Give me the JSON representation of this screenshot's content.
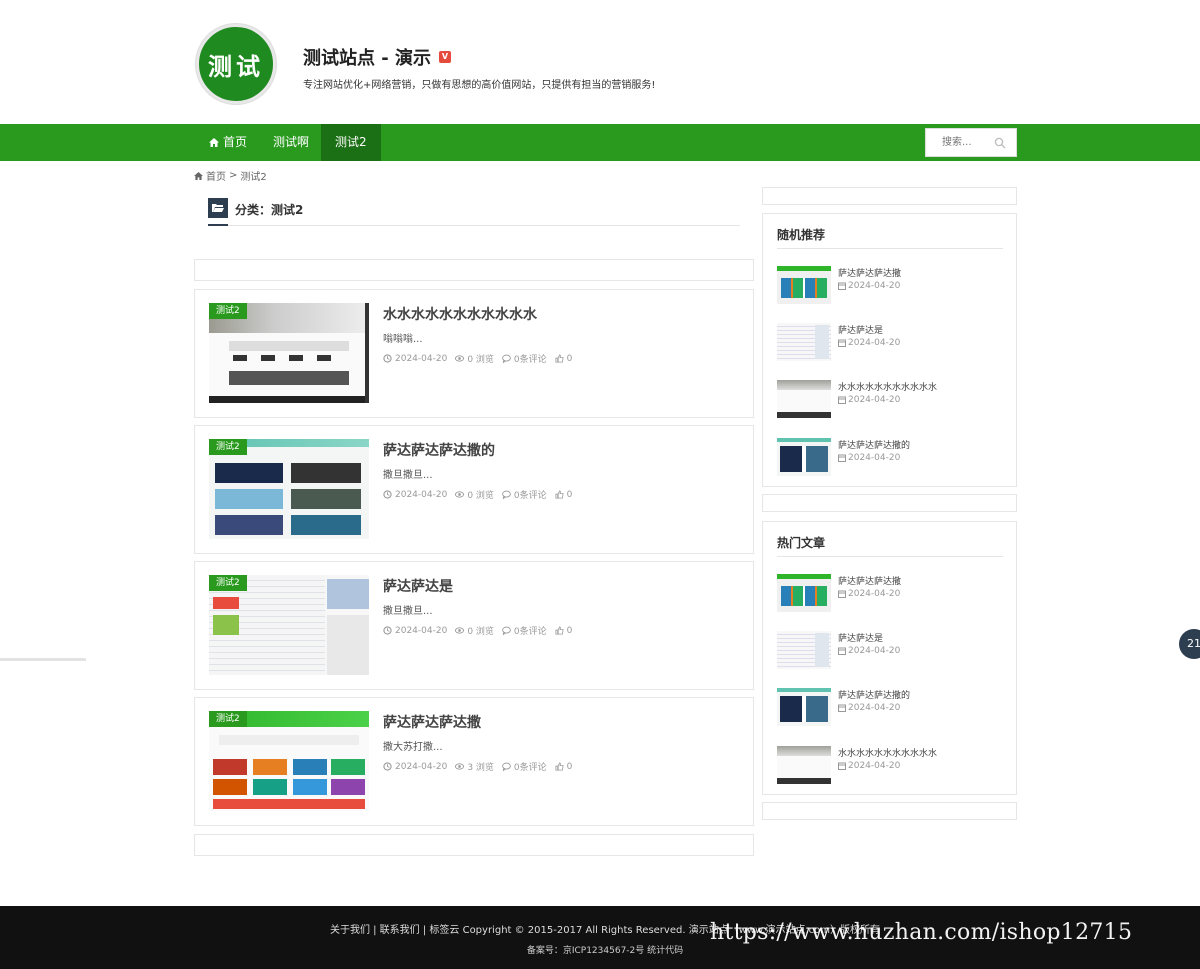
{
  "header": {
    "logo_text": "测试",
    "site_title": "测试站点 - 演示",
    "verified_badge": "V",
    "site_desc": "专注网站优化+网络营销，只做有思想的高价值网站，只提供有担当的营销服务!"
  },
  "nav": {
    "items": [
      {
        "label": "首页",
        "icon": "home-icon"
      },
      {
        "label": "测试啊"
      },
      {
        "label": "测试2",
        "active": true
      }
    ],
    "search_placeholder": "搜索..."
  },
  "breadcrumb": {
    "home": "首页",
    "sep": ">",
    "current": "测试2"
  },
  "category": {
    "label": "分类：测试2"
  },
  "posts": [
    {
      "tag": "测试2",
      "title": "水水水水水水水水水水水",
      "excerpt": "嗡嗡嗡...",
      "date": "2024-04-20",
      "views": "0 浏览",
      "comments": "0条评论",
      "likes": "0"
    },
    {
      "tag": "测试2",
      "title": "萨达萨达萨达撒的",
      "excerpt": "撒旦撒旦...",
      "date": "2024-04-20",
      "views": "0 浏览",
      "comments": "0条评论",
      "likes": "0"
    },
    {
      "tag": "测试2",
      "title": "萨达萨达是",
      "excerpt": "撒旦撒旦...",
      "date": "2024-04-20",
      "views": "0 浏览",
      "comments": "0条评论",
      "likes": "0"
    },
    {
      "tag": "测试2",
      "title": "萨达萨达萨达撒",
      "excerpt": "撒大苏打撒...",
      "date": "2024-04-20",
      "views": "3 浏览",
      "comments": "0条评论",
      "likes": "0"
    }
  ],
  "sidebar": {
    "random": {
      "title": "随机推荐",
      "items": [
        {
          "title": "萨达萨达萨达撒",
          "date": "2024-04-20"
        },
        {
          "title": "萨达萨达是",
          "date": "2024-04-20"
        },
        {
          "title": "水水水水水水水水水水水",
          "date": "2024-04-20"
        },
        {
          "title": "萨达萨达萨达撒的",
          "date": "2024-04-20"
        }
      ]
    },
    "hot": {
      "title": "热门文章",
      "items": [
        {
          "title": "萨达萨达萨达撒",
          "date": "2024-04-20"
        },
        {
          "title": "萨达萨达是",
          "date": "2024-04-20"
        },
        {
          "title": "萨达萨达萨达撒的",
          "date": "2024-04-20"
        },
        {
          "title": "水水水水水水水水水水水",
          "date": "2024-04-20"
        }
      ]
    }
  },
  "float_bubble": "21",
  "footer": {
    "line1": "关于我们 | 联系我们 | 标签云 Copyright © 2015-2017 All Rights Reserved. 演示站点（www.演示站点.com）版权所有",
    "line2": "备案号：京ICP1234567-2号 统计代码"
  },
  "watermark": "https://www.huzhan.com/ishop12715",
  "colors": {
    "brand_green": "#2a9a1f",
    "nav_active": "#1b6f14",
    "dark": "#2c3e50",
    "footer_bg": "#111111"
  }
}
